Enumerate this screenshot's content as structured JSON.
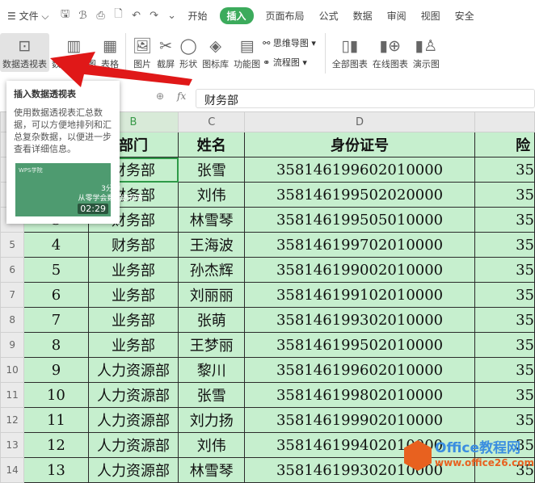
{
  "menubar": {
    "menu_icon": "hamburger-icon",
    "file": "文件",
    "tabs": [
      "开始",
      "插入",
      "页面布局",
      "公式",
      "数据",
      "审阅",
      "视图",
      "安全"
    ],
    "active_tab": "插入"
  },
  "ribbon": {
    "pivot_table": "数据透视表",
    "pivot_chart": "数据透视图",
    "table": "表格",
    "picture": "图片",
    "screenshot": "截屏",
    "shape": "形状",
    "icon_lib": "图标库",
    "func_chart": "功能图",
    "mindmap": "思维导图",
    "flowchart": "流程图",
    "all_charts": "全部图表",
    "online_charts": "在线图表",
    "demo_chart": "演示图"
  },
  "formula_bar": {
    "fx": "fx",
    "value": "财务部"
  },
  "tooltip": {
    "title": "插入数据透视表",
    "body": "使用数据透视表汇总数据，可以方便地排列和汇总复杂数据，以便进一步查看详细信息。",
    "video_brand": "WPS学院",
    "video_line1": "3分钟",
    "video_line2": "从零学会数据透视表",
    "duration": "02:29"
  },
  "sheet": {
    "columns": [
      "B",
      "C",
      "D"
    ],
    "header": [
      "部门",
      "姓名",
      "身份证号",
      "险"
    ],
    "rows": [
      [
        "2",
        "1",
        "财务部",
        "张雪",
        "358146199602010000",
        "35"
      ],
      [
        "3",
        "2",
        "财务部",
        "刘伟",
        "358146199502020000",
        "35"
      ],
      [
        "4",
        "3",
        "财务部",
        "林雪琴",
        "358146199505010000",
        "35"
      ],
      [
        "5",
        "4",
        "财务部",
        "王海波",
        "358146199702010000",
        "35"
      ],
      [
        "6",
        "5",
        "业务部",
        "孙杰辉",
        "358146199002010000",
        "35"
      ],
      [
        "7",
        "6",
        "业务部",
        "刘丽丽",
        "358146199102010000",
        "35"
      ],
      [
        "8",
        "7",
        "业务部",
        "张萌",
        "358146199302010000",
        "35"
      ],
      [
        "9",
        "8",
        "业务部",
        "王梦丽",
        "358146199502010000",
        "35"
      ],
      [
        "10",
        "9",
        "人力资源部",
        "黎川",
        "358146199602010000",
        "35"
      ],
      [
        "11",
        "10",
        "人力资源部",
        "张雪",
        "358146199802010000",
        "35"
      ],
      [
        "12",
        "11",
        "人力资源部",
        "刘力扬",
        "358146199902010000",
        "35"
      ],
      [
        "13",
        "12",
        "人力资源部",
        "刘伟",
        "358146199402010000",
        "35"
      ],
      [
        "14",
        "13",
        "人力资源部",
        "林雪琴",
        "358146199302010000",
        "35"
      ]
    ]
  },
  "watermark": {
    "name": "Office教程网",
    "url": "www.office26.com"
  },
  "colors": {
    "accent": "#3cab5c",
    "cell_fill": "#c6efce",
    "arrow": "#e01818"
  }
}
